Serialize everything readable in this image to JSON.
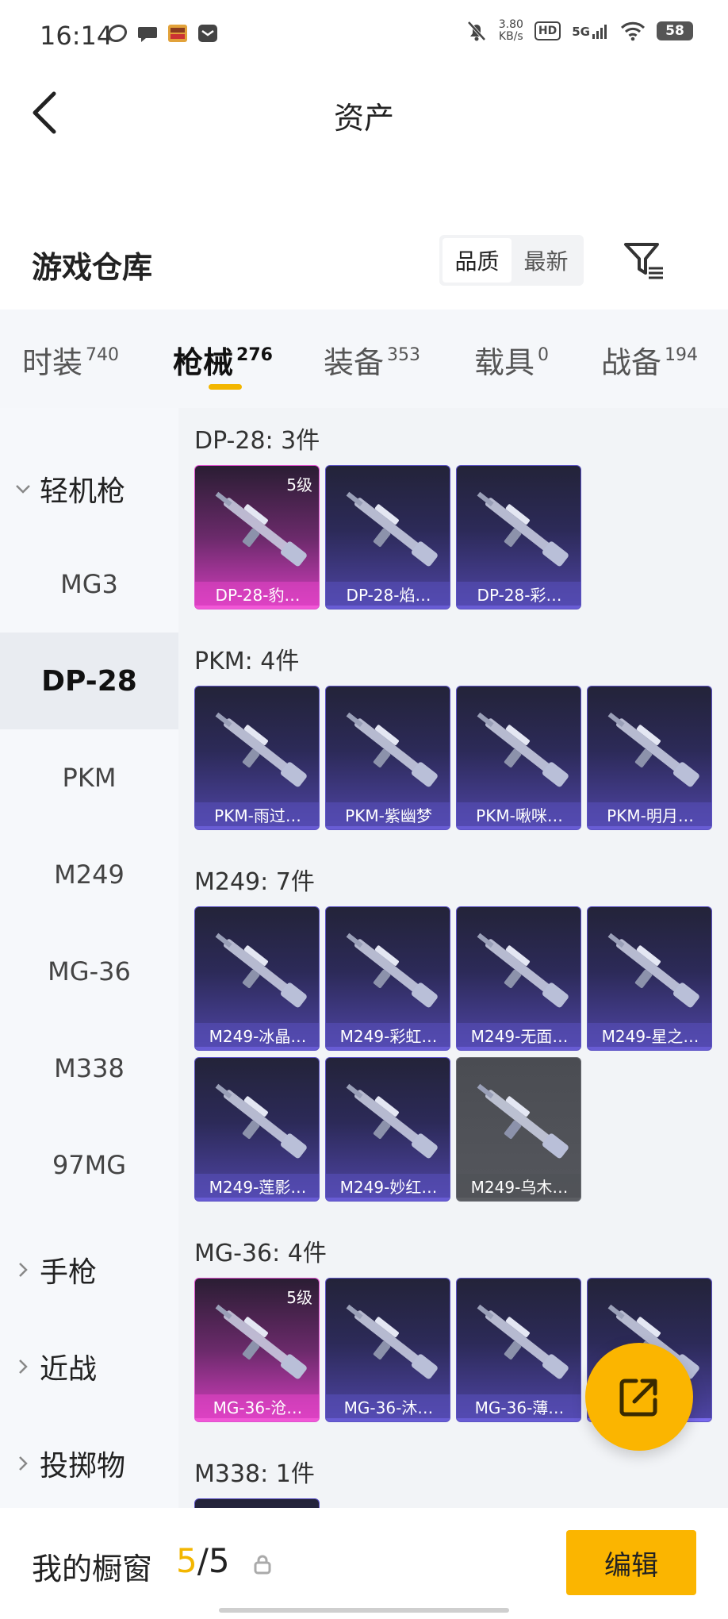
{
  "status": {
    "time": "16:14",
    "net_speed_value": "3.80",
    "net_speed_unit": "KB/s",
    "hd": "HD",
    "signal": "5G",
    "battery": "58"
  },
  "header": {
    "title": "资产"
  },
  "warehouse": {
    "title": "游戏仓库",
    "sort_options": [
      "品质",
      "最新"
    ],
    "selected_sort": "品质"
  },
  "tabs": [
    {
      "label": "时装",
      "count": "740"
    },
    {
      "label": "枪械",
      "count": "276",
      "active": true
    },
    {
      "label": "装备",
      "count": "353"
    },
    {
      "label": "载具",
      "count": "0"
    },
    {
      "label": "战备",
      "count": "194"
    }
  ],
  "sidebar": {
    "category_open": "轻机枪",
    "items": [
      "MG3",
      "DP-28",
      "PKM",
      "M249",
      "MG-36",
      "M338",
      "97MG"
    ],
    "selected": "DP-28",
    "collapsed": [
      "手枪",
      "近战",
      "投掷物"
    ]
  },
  "sections": [
    {
      "title": "DP-28: 3件",
      "items": [
        {
          "name": "DP-28-豹…",
          "tier": "pink",
          "level": "5级"
        },
        {
          "name": "DP-28-焰…",
          "tier": "purple"
        },
        {
          "name": "DP-28-彩…",
          "tier": "purple"
        }
      ]
    },
    {
      "title": "PKM: 4件",
      "items": [
        {
          "name": "PKM-雨过…",
          "tier": "purple"
        },
        {
          "name": "PKM-紫幽梦",
          "tier": "purple"
        },
        {
          "name": "PKM-啾咪…",
          "tier": "purple"
        },
        {
          "name": "PKM-明月…",
          "tier": "purple"
        }
      ]
    },
    {
      "title": "M249: 7件",
      "items": [
        {
          "name": "M249-冰晶…",
          "tier": "purple"
        },
        {
          "name": "M249-彩虹…",
          "tier": "purple"
        },
        {
          "name": "M249-无面…",
          "tier": "purple"
        },
        {
          "name": "M249-星之…",
          "tier": "purple"
        },
        {
          "name": "M249-莲影…",
          "tier": "purple"
        },
        {
          "name": "M249-妙红…",
          "tier": "purple"
        },
        {
          "name": "M249-乌木…",
          "tier": "grey"
        }
      ]
    },
    {
      "title": "MG-36: 4件",
      "items": [
        {
          "name": "MG-36-沧…",
          "tier": "pink",
          "level": "5级"
        },
        {
          "name": "MG-36-沐…",
          "tier": "purple"
        },
        {
          "name": "MG-36-薄…",
          "tier": "purple"
        },
        {
          "name": "",
          "tier": "purple"
        }
      ]
    },
    {
      "title": "M338: 1件",
      "items": [
        {
          "name": "",
          "tier": "purple"
        }
      ]
    }
  ],
  "showcase": {
    "label": "我的橱窗",
    "current": "5",
    "separator": "/",
    "max": "5"
  },
  "edit_button": {
    "label": "编辑"
  },
  "colors": {
    "accent": "#fbb500",
    "tab_indicator": "#f3b600"
  }
}
